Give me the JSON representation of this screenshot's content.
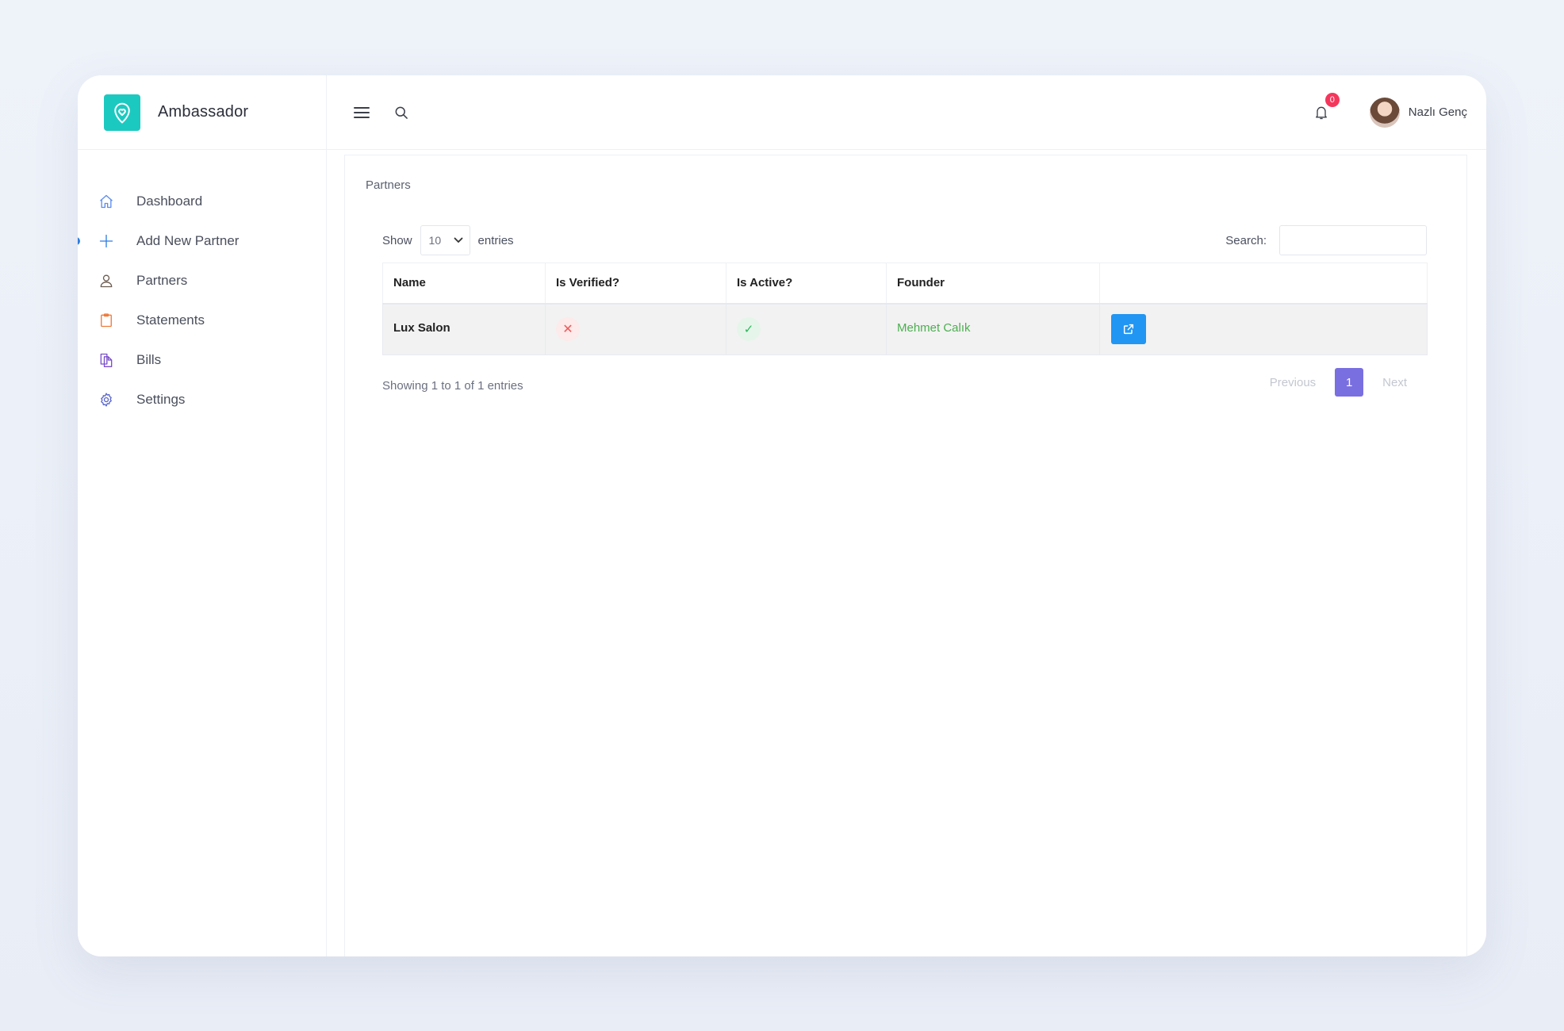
{
  "app": {
    "name": "Ambassador",
    "accent": "#1cc9c0"
  },
  "sidebar": {
    "items": [
      {
        "label": "Dashboard",
        "icon": "home-icon",
        "color": "#5b8def"
      },
      {
        "label": "Add New Partner",
        "icon": "plus-icon",
        "color": "#2e7ce0",
        "active": true
      },
      {
        "label": "Partners",
        "icon": "user-icon",
        "color": "#6b5a4e"
      },
      {
        "label": "Statements",
        "icon": "clipboard-icon",
        "color": "#f07a3a"
      },
      {
        "label": "Bills",
        "icon": "documents-icon",
        "color": "#7b4fc9"
      },
      {
        "label": "Settings",
        "icon": "gear-icon",
        "color": "#5a67c9"
      }
    ]
  },
  "topbar": {
    "notification_count": "0",
    "user_name": "Nazlı Genç"
  },
  "page": {
    "title": "Partners",
    "length": {
      "prefix": "Show",
      "value": "10",
      "suffix": "entries"
    },
    "search": {
      "label": "Search:",
      "value": ""
    },
    "table": {
      "columns": [
        "Name",
        "Is Verified?",
        "Is Active?",
        "Founder",
        ""
      ],
      "rows": [
        {
          "name": "Lux Salon",
          "verified": "✕",
          "active": "✓",
          "founder": "Mehmet Calık"
        }
      ]
    },
    "info": "Showing 1 to 1 of 1 entries",
    "pagination": {
      "previous": "Previous",
      "current": "1",
      "next": "Next"
    }
  }
}
